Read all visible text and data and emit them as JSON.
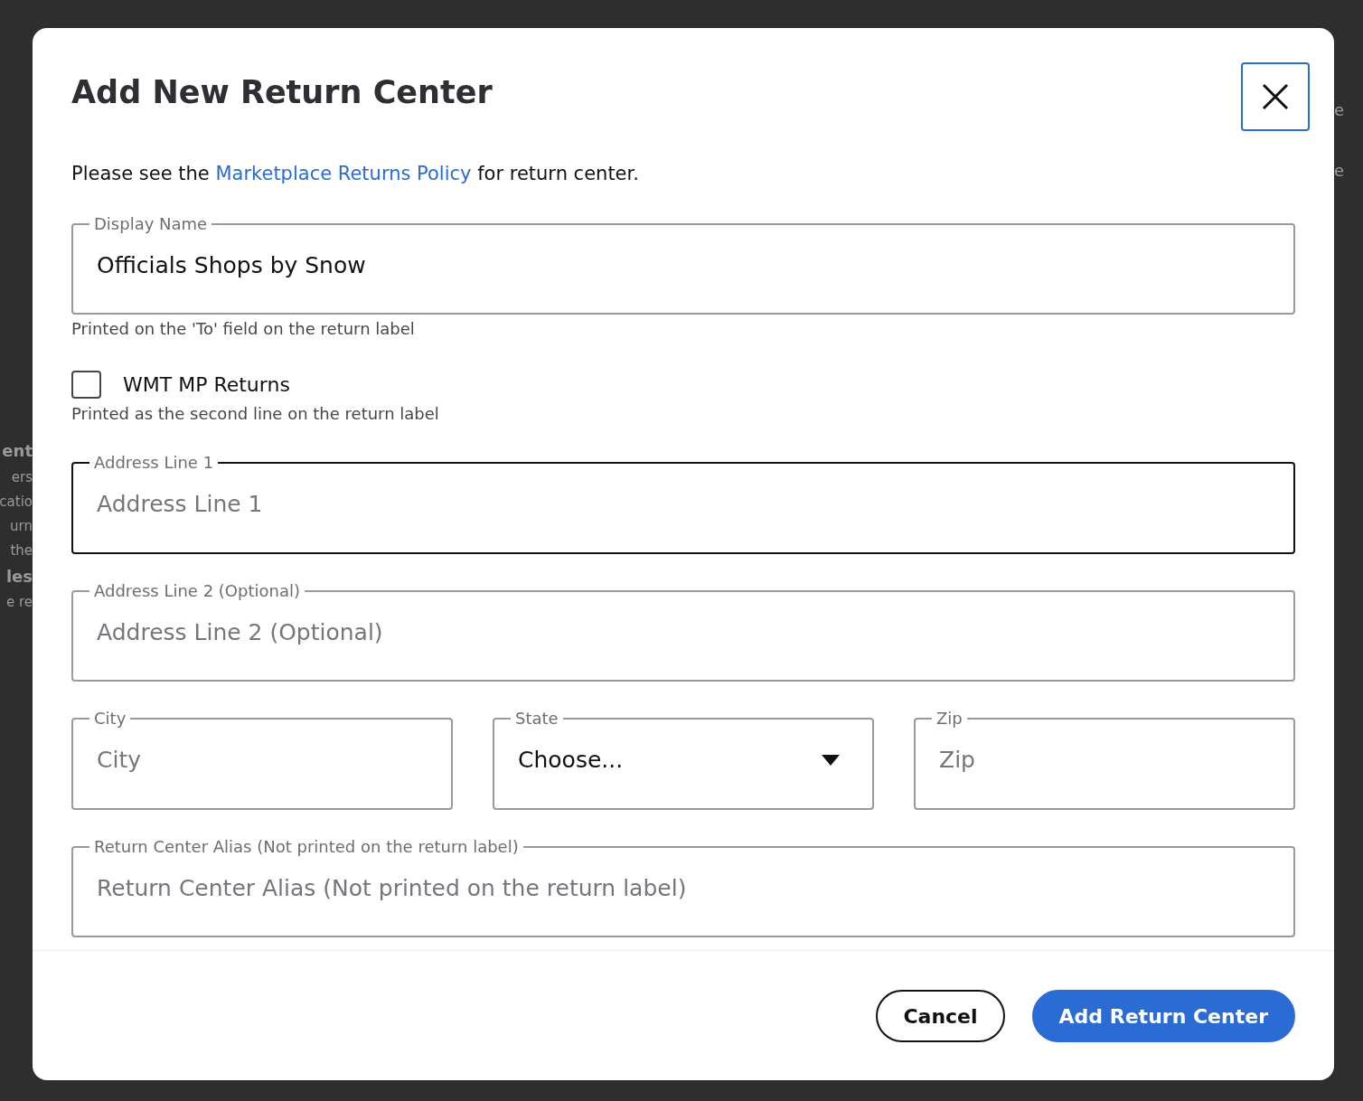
{
  "backdrop": {
    "left_fragments": [
      {
        "text": "ent",
        "bold": true
      },
      {
        "text": "ers",
        "bold": false
      },
      {
        "text": "catio",
        "bold": false
      },
      {
        "text": "urn",
        "bold": false
      },
      {
        "text": "the",
        "bold": false
      },
      {
        "text": "les",
        "bold": true
      },
      {
        "text": "e re",
        "bold": false
      }
    ],
    "right_fragments": [
      "e",
      "e"
    ]
  },
  "dialog": {
    "title": "Add New Return Center",
    "close_button": {
      "focused": true
    },
    "intro": {
      "before": "Please see the ",
      "link": "Marketplace Returns Policy",
      "after": " for return center."
    },
    "form": [
      {
        "kind": "field",
        "label": "Display Name",
        "value": "Officials Shops by Snow",
        "focused": false,
        "help": "Printed on the 'To' field on the return label"
      },
      {
        "kind": "checkbox",
        "label": "WMT MP Returns",
        "checked": false,
        "help": "Printed as the second line on the return label"
      },
      {
        "kind": "field",
        "label": "Address Line 1",
        "placeholder": "Address Line 1",
        "focused": true
      },
      {
        "kind": "field",
        "label": "Address Line 2 (Optional)",
        "placeholder": "Address Line 2 (Optional)",
        "focused": false
      },
      {
        "kind": "field_row",
        "fields": [
          {
            "kind": "field",
            "label": "City",
            "placeholder": "City",
            "focused": false
          },
          {
            "kind": "select",
            "label": "State",
            "value": "Choose...",
            "focused": false
          },
          {
            "kind": "field",
            "label": "Zip",
            "placeholder": "Zip",
            "focused": false
          }
        ]
      },
      {
        "kind": "field",
        "label": "Return Center Alias (Not printed on the return label)",
        "placeholder": "Return Center Alias (Not printed on the return label)",
        "focused": false
      }
    ],
    "buttons": [
      {
        "label": "Cancel",
        "kind": "secondary"
      },
      {
        "label": "Add Return Center",
        "kind": "primary"
      }
    ]
  }
}
